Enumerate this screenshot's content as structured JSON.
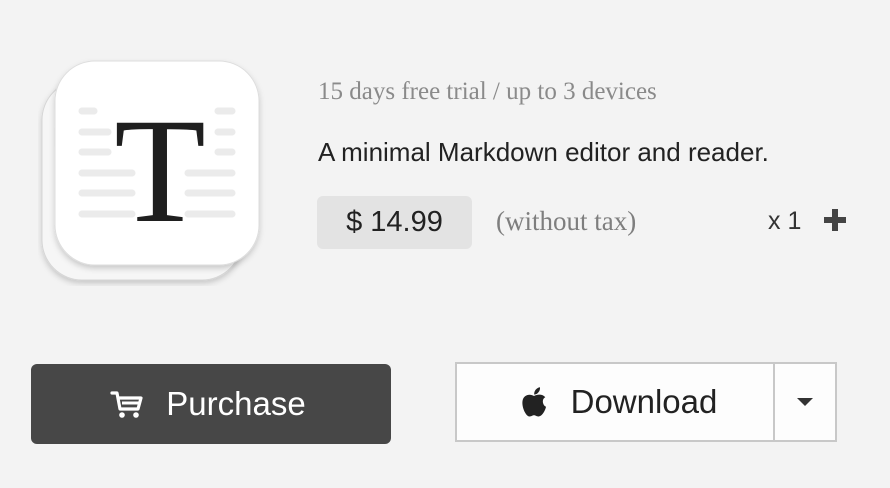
{
  "app": {
    "icon_name": "markdown-editor-app-icon",
    "icon_glyph": "T"
  },
  "info": {
    "trial": "15 days free trial / up to 3 devices",
    "tagline": "A minimal Markdown editor and reader.",
    "price": "$ 14.99",
    "tax_note": "(without tax)",
    "quantity": "x 1"
  },
  "actions": {
    "purchase_label": "Purchase",
    "purchase_icon": "cart-icon",
    "download_label": "Download",
    "download_icon": "apple-icon",
    "dropdown_icon": "caret-down-icon"
  },
  "colors": {
    "background": "#f3f3f3",
    "purchase_button": "#474747",
    "price_badge": "#e3e3e3"
  }
}
